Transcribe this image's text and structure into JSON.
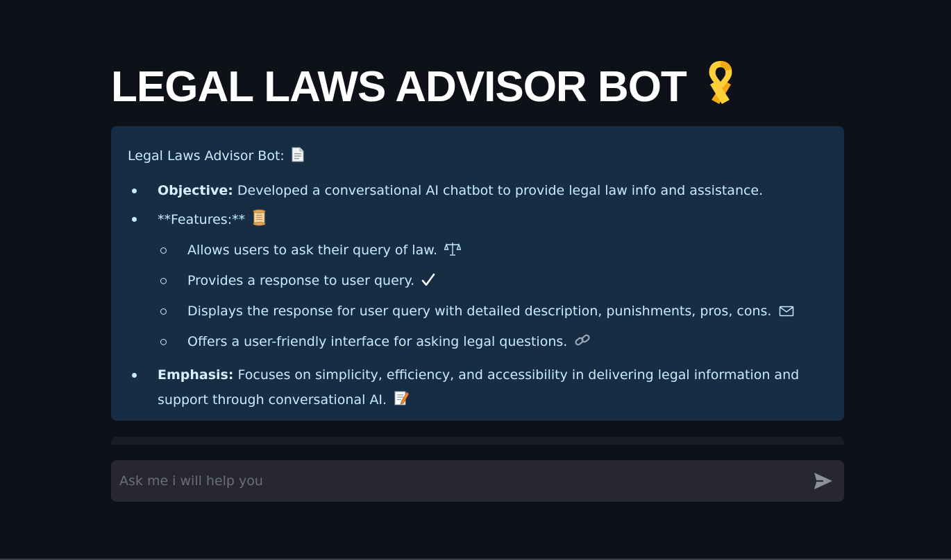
{
  "app": {
    "title": "LEGAL LAWS ADVISOR BOT",
    "title_icon": "yellow-ribbon-icon"
  },
  "info": {
    "heading": "Legal Laws Advisor Bot:",
    "heading_icon": "page-icon",
    "objective": {
      "label": "Objective:",
      "text": " Developed a conversational AI chatbot to provide legal law info and assistance."
    },
    "features": {
      "label": "**Features:**",
      "icon": "scroll-icon",
      "items": [
        {
          "text": "Allows users to ask their query of law.",
          "icon": "scales-icon"
        },
        {
          "text": "Provides a response to user query.",
          "icon": "checkmark-icon"
        },
        {
          "text": "Displays the response for user query with detailed description, punishments, pros, cons.",
          "icon": "envelope-icon"
        },
        {
          "text": "Offers a user-friendly interface for asking legal questions.",
          "icon": "link-icon"
        }
      ]
    },
    "emphasis": {
      "label": "Emphasis:",
      "text": " Focuses on simplicity, efficiency, and accessibility in delivering legal information and support through conversational AI.",
      "icon": "memo-icon"
    }
  },
  "chat_input": {
    "placeholder": "Ask me i will help you",
    "value": "",
    "send_icon": "send-icon"
  },
  "colors": {
    "background": "#0e1117",
    "info_box": "#172d43",
    "info_text": "#c7ebff",
    "input_bg": "#262730",
    "title": "#ffffff"
  }
}
